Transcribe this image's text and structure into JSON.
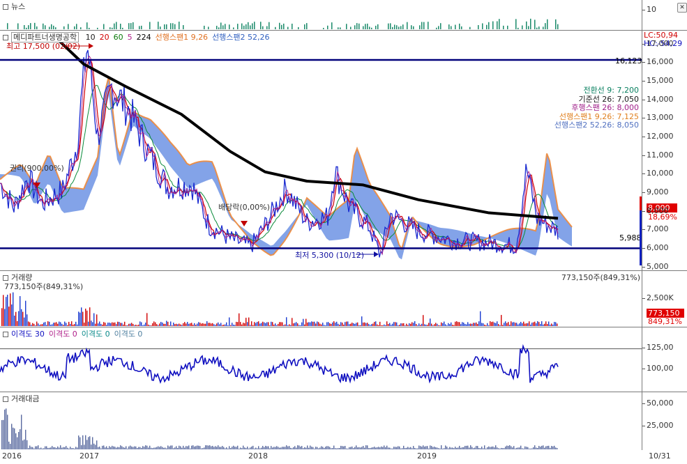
{
  "panels": {
    "news": {
      "title": "뉴스",
      "axis_ticks": [
        "10"
      ]
    },
    "price": {
      "title": "메디파트너생명공학",
      "ma_legend": [
        {
          "label": "10",
          "color": "#1a1a1a"
        },
        {
          "label": "20",
          "color": "#d00000"
        },
        {
          "label": "60",
          "color": "#0a7a0a"
        },
        {
          "label": "5",
          "color": "#b0208a"
        },
        {
          "label": "224",
          "color": "#000000"
        },
        {
          "label": "선행스팬1 9,26",
          "color": "#e07020"
        },
        {
          "label": "선행스팬2 52,26",
          "color": "#3060c0"
        }
      ],
      "lc": "LC:50,94",
      "hc": "HC:-54,29",
      "axis_ticks": [
        "17,000",
        "16,000",
        "15,000",
        "14,000",
        "13,000",
        "12,000",
        "11,000",
        "10,000",
        "9,000",
        "8,000",
        "7,000",
        "6,000",
        "5,000"
      ],
      "hline_high": "16,123",
      "hline_low": "5,988",
      "max_annot": "최고 17,500 (02/02)",
      "min_annot": "최저 5,300 (10/12)",
      "annot_1": "권리(900,00%)",
      "annot_2": "배당락(0,00%)",
      "ichimoku": [
        {
          "label": "전환선 9: 7,200",
          "color": "#0a8060"
        },
        {
          "label": "기준선 26: 7,050",
          "color": "#1a1a1a"
        },
        {
          "label": "후행스팬 26: 8,000",
          "color": "#a0208a"
        },
        {
          "label": "선행스팬1 9,26: 7,125",
          "color": "#e08020"
        },
        {
          "label": "선행스팬2 52,26: 8,050",
          "color": "#5070c0"
        }
      ],
      "price_tag": "8,000",
      "pct_tag": "18,69%"
    },
    "volume": {
      "title": "거래량",
      "sub": "773,150주(849,31%)",
      "right_label": "773,150주(849,31%)",
      "axis_ticks": [
        "2,500K"
      ],
      "value_tag": "773,150",
      "pct_tag": "849,31%"
    },
    "disparity": {
      "title_items": [
        {
          "label": "이격도 30",
          "color": "#1010c0"
        },
        {
          "label": "이격도 0",
          "color": "#b0208a"
        },
        {
          "label": "이격도 0",
          "color": "#0a8a8a"
        },
        {
          "label": "이격도 0",
          "color": "#5080a0"
        }
      ],
      "axis_ticks": [
        "125,00",
        "100,00"
      ]
    },
    "amount": {
      "title": "거래대금",
      "axis_ticks": [
        "50,000",
        "25,000"
      ]
    }
  },
  "x_labels": [
    "2016",
    "2017",
    "2018",
    "2019",
    "10/31"
  ],
  "chart_data": {
    "type": "line",
    "title": "메디파트너생명공학",
    "x": [
      "2016",
      "2017",
      "2018",
      "2019"
    ],
    "ylim": [
      5000,
      17500
    ],
    "series": [
      {
        "name": "224",
        "values": [
          17500,
          13500,
          9200,
          8100,
          7300,
          7050
        ]
      },
      {
        "name": "선행스팬1 9,26",
        "values": [
          7125
        ]
      },
      {
        "name": "선행스팬2 52,26",
        "values": [
          8050
        ]
      }
    ],
    "annotations": [
      "최고 17,500 (02/02)",
      "최저 5,300 (10/12)",
      "16,123",
      "5,988"
    ],
    "disparity_ylim": [
      80,
      140
    ],
    "volume_last": "773,150주(849,31%)"
  },
  "colors": {
    "navy": "#00007a",
    "blue": "#1010c0",
    "red": "#d00000",
    "orange": "#ee8a3a",
    "cloud": "#5a84e0"
  }
}
